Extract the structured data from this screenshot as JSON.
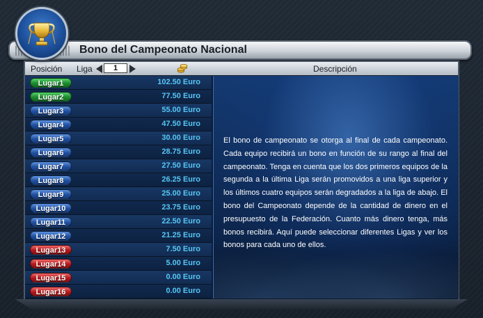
{
  "window": {
    "title": "Bono del Campeonato Nacional"
  },
  "header": {
    "position_label": "Posición",
    "liga_label": "Liga",
    "liga_value": "1",
    "description_label": "Descripción"
  },
  "rows": [
    {
      "label": "Lugar1",
      "amount": "102.50 Euro",
      "color": "green"
    },
    {
      "label": "Lugar2",
      "amount": "77.50 Euro",
      "color": "green"
    },
    {
      "label": "Lugar3",
      "amount": "55.00 Euro",
      "color": "blue"
    },
    {
      "label": "Lugar4",
      "amount": "47.50 Euro",
      "color": "blue"
    },
    {
      "label": "Lugar5",
      "amount": "30.00 Euro",
      "color": "blue"
    },
    {
      "label": "Lugar6",
      "amount": "28.75 Euro",
      "color": "blue"
    },
    {
      "label": "Lugar7",
      "amount": "27.50 Euro",
      "color": "blue"
    },
    {
      "label": "Lugar8",
      "amount": "26.25 Euro",
      "color": "blue"
    },
    {
      "label": "Lugar9",
      "amount": "25.00 Euro",
      "color": "blue"
    },
    {
      "label": "Lugar10",
      "amount": "23.75 Euro",
      "color": "blue"
    },
    {
      "label": "Lugar11",
      "amount": "22.50 Euro",
      "color": "blue"
    },
    {
      "label": "Lugar12",
      "amount": "21.25 Euro",
      "color": "blue"
    },
    {
      "label": "Lugar13",
      "amount": "7.50 Euro",
      "color": "red"
    },
    {
      "label": "Lugar14",
      "amount": "5.00 Euro",
      "color": "red"
    },
    {
      "label": "Lugar15",
      "amount": "0.00 Euro",
      "color": "red"
    },
    {
      "label": "Lugar16",
      "amount": "0.00 Euro",
      "color": "red"
    }
  ],
  "description": "El bono de campeonato se otorga al final de cada campeonato. Cada equipo recibirá un bono en función de su rango al final del campeonato. Tenga en cuenta que los dos primeros equipos de la segunda a la última Liga serán promovidos a una liga superior y los últimos cuatro equipos serán degradados a la liga de abajo. El bono del Campeonato depende de la cantidad de dinero en el presupuesto de la Federación. Cuanto más dinero tenga, más bonos recibirá. Aquí puede seleccionar diferentes Ligas y ver los bonos para cada uno de ellos.",
  "icons": {
    "emblem": "trophy-icon",
    "liga_prev": "arrow-left-icon",
    "liga_next": "arrow-right-icon",
    "money": "coins-icon"
  },
  "colors": {
    "accent_amount": "#56c6f5",
    "promoted": "#1e8a2e",
    "neutral": "#21509f",
    "relegated": "#b2191c"
  }
}
